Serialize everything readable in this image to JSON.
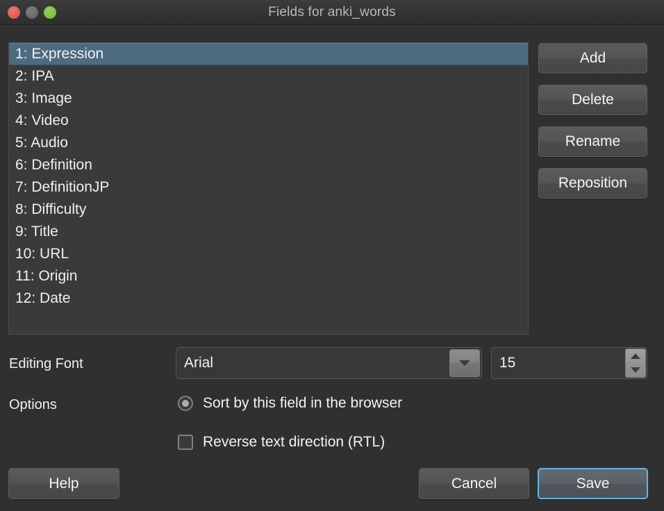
{
  "window": {
    "title": "Fields for anki_words",
    "traffic_lights": [
      {
        "name": "close-button",
        "color": "#e0564c"
      },
      {
        "name": "minimize-button",
        "color": "#6a6a6a"
      },
      {
        "name": "zoom-button",
        "color": "#79c140"
      }
    ]
  },
  "field_list": {
    "selected_index": 0,
    "selection_color": "#4d6b7f",
    "items": [
      "1: Expression",
      "2: IPA",
      "3: Image",
      "4: Video",
      "5: Audio",
      "6: Definition",
      "7: DefinitionJP",
      "8: Difficulty",
      "9: Title",
      "10: URL",
      "11: Origin",
      "12: Date"
    ]
  },
  "side_buttons": [
    {
      "name": "add-button",
      "label": "Add"
    },
    {
      "name": "delete-button",
      "label": "Delete"
    },
    {
      "name": "rename-button",
      "label": "Rename"
    },
    {
      "name": "reposition-button",
      "label": "Reposition"
    }
  ],
  "editing_font": {
    "label": "Editing Font",
    "family_value": "Arial",
    "size_value": "15",
    "dropdown_icon": "chevron-down-icon",
    "stepper_up_icon": "triangle-up-icon",
    "stepper_down_icon": "triangle-down-icon"
  },
  "options": {
    "label": "Options",
    "sort_field": {
      "label": "Sort by this field in the browser",
      "checked": true,
      "control": "radio"
    },
    "rtl": {
      "label": "Reverse text direction (RTL)",
      "checked": false,
      "control": "checkbox"
    }
  },
  "bottom_buttons": {
    "help": "Help",
    "cancel": "Cancel",
    "save": "Save",
    "save_focus_color": "#63b4e8"
  }
}
